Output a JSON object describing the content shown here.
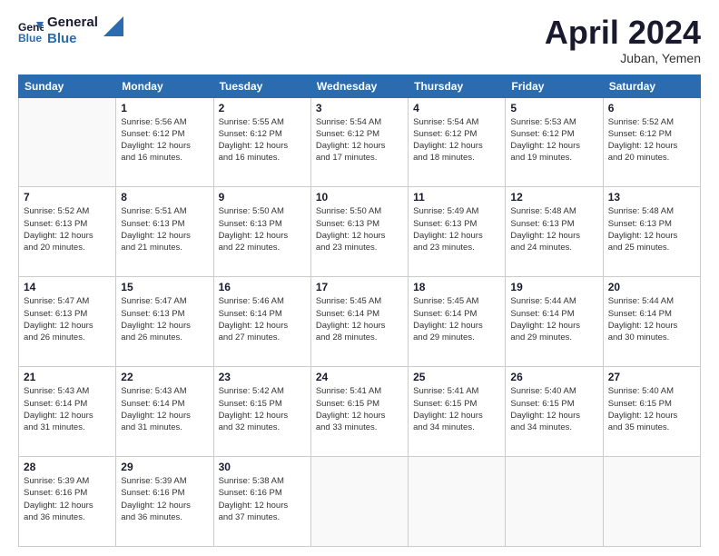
{
  "header": {
    "logo_line1": "General",
    "logo_line2": "Blue",
    "month": "April 2024",
    "location": "Juban, Yemen"
  },
  "weekdays": [
    "Sunday",
    "Monday",
    "Tuesday",
    "Wednesday",
    "Thursday",
    "Friday",
    "Saturday"
  ],
  "weeks": [
    [
      {
        "day": "",
        "info": ""
      },
      {
        "day": "1",
        "info": "Sunrise: 5:56 AM\nSunset: 6:12 PM\nDaylight: 12 hours\nand 16 minutes."
      },
      {
        "day": "2",
        "info": "Sunrise: 5:55 AM\nSunset: 6:12 PM\nDaylight: 12 hours\nand 16 minutes."
      },
      {
        "day": "3",
        "info": "Sunrise: 5:54 AM\nSunset: 6:12 PM\nDaylight: 12 hours\nand 17 minutes."
      },
      {
        "day": "4",
        "info": "Sunrise: 5:54 AM\nSunset: 6:12 PM\nDaylight: 12 hours\nand 18 minutes."
      },
      {
        "day": "5",
        "info": "Sunrise: 5:53 AM\nSunset: 6:12 PM\nDaylight: 12 hours\nand 19 minutes."
      },
      {
        "day": "6",
        "info": "Sunrise: 5:52 AM\nSunset: 6:12 PM\nDaylight: 12 hours\nand 20 minutes."
      }
    ],
    [
      {
        "day": "7",
        "info": "Sunrise: 5:52 AM\nSunset: 6:13 PM\nDaylight: 12 hours\nand 20 minutes."
      },
      {
        "day": "8",
        "info": "Sunrise: 5:51 AM\nSunset: 6:13 PM\nDaylight: 12 hours\nand 21 minutes."
      },
      {
        "day": "9",
        "info": "Sunrise: 5:50 AM\nSunset: 6:13 PM\nDaylight: 12 hours\nand 22 minutes."
      },
      {
        "day": "10",
        "info": "Sunrise: 5:50 AM\nSunset: 6:13 PM\nDaylight: 12 hours\nand 23 minutes."
      },
      {
        "day": "11",
        "info": "Sunrise: 5:49 AM\nSunset: 6:13 PM\nDaylight: 12 hours\nand 23 minutes."
      },
      {
        "day": "12",
        "info": "Sunrise: 5:48 AM\nSunset: 6:13 PM\nDaylight: 12 hours\nand 24 minutes."
      },
      {
        "day": "13",
        "info": "Sunrise: 5:48 AM\nSunset: 6:13 PM\nDaylight: 12 hours\nand 25 minutes."
      }
    ],
    [
      {
        "day": "14",
        "info": "Sunrise: 5:47 AM\nSunset: 6:13 PM\nDaylight: 12 hours\nand 26 minutes."
      },
      {
        "day": "15",
        "info": "Sunrise: 5:47 AM\nSunset: 6:13 PM\nDaylight: 12 hours\nand 26 minutes."
      },
      {
        "day": "16",
        "info": "Sunrise: 5:46 AM\nSunset: 6:14 PM\nDaylight: 12 hours\nand 27 minutes."
      },
      {
        "day": "17",
        "info": "Sunrise: 5:45 AM\nSunset: 6:14 PM\nDaylight: 12 hours\nand 28 minutes."
      },
      {
        "day": "18",
        "info": "Sunrise: 5:45 AM\nSunset: 6:14 PM\nDaylight: 12 hours\nand 29 minutes."
      },
      {
        "day": "19",
        "info": "Sunrise: 5:44 AM\nSunset: 6:14 PM\nDaylight: 12 hours\nand 29 minutes."
      },
      {
        "day": "20",
        "info": "Sunrise: 5:44 AM\nSunset: 6:14 PM\nDaylight: 12 hours\nand 30 minutes."
      }
    ],
    [
      {
        "day": "21",
        "info": "Sunrise: 5:43 AM\nSunset: 6:14 PM\nDaylight: 12 hours\nand 31 minutes."
      },
      {
        "day": "22",
        "info": "Sunrise: 5:43 AM\nSunset: 6:14 PM\nDaylight: 12 hours\nand 31 minutes."
      },
      {
        "day": "23",
        "info": "Sunrise: 5:42 AM\nSunset: 6:15 PM\nDaylight: 12 hours\nand 32 minutes."
      },
      {
        "day": "24",
        "info": "Sunrise: 5:41 AM\nSunset: 6:15 PM\nDaylight: 12 hours\nand 33 minutes."
      },
      {
        "day": "25",
        "info": "Sunrise: 5:41 AM\nSunset: 6:15 PM\nDaylight: 12 hours\nand 34 minutes."
      },
      {
        "day": "26",
        "info": "Sunrise: 5:40 AM\nSunset: 6:15 PM\nDaylight: 12 hours\nand 34 minutes."
      },
      {
        "day": "27",
        "info": "Sunrise: 5:40 AM\nSunset: 6:15 PM\nDaylight: 12 hours\nand 35 minutes."
      }
    ],
    [
      {
        "day": "28",
        "info": "Sunrise: 5:39 AM\nSunset: 6:16 PM\nDaylight: 12 hours\nand 36 minutes."
      },
      {
        "day": "29",
        "info": "Sunrise: 5:39 AM\nSunset: 6:16 PM\nDaylight: 12 hours\nand 36 minutes."
      },
      {
        "day": "30",
        "info": "Sunrise: 5:38 AM\nSunset: 6:16 PM\nDaylight: 12 hours\nand 37 minutes."
      },
      {
        "day": "",
        "info": ""
      },
      {
        "day": "",
        "info": ""
      },
      {
        "day": "",
        "info": ""
      },
      {
        "day": "",
        "info": ""
      }
    ]
  ]
}
